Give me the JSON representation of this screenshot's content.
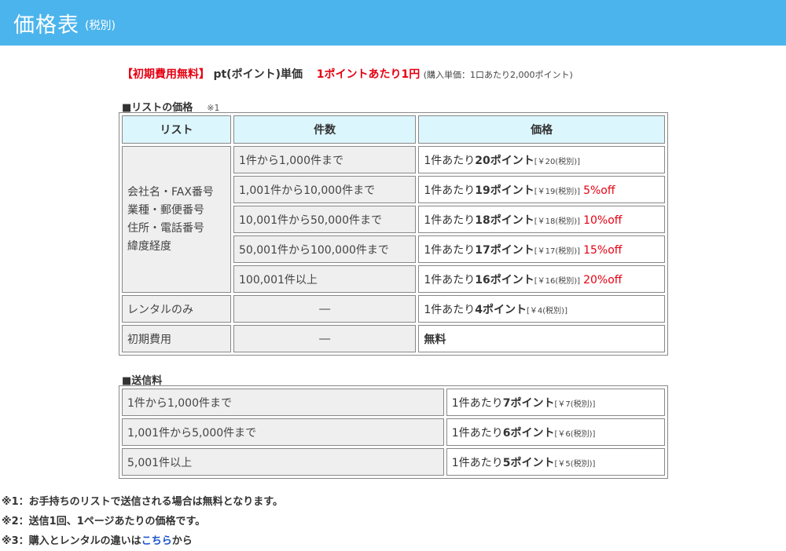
{
  "header": {
    "title": "価格表",
    "subtitle": "(税別)"
  },
  "intro": {
    "free_label": "【初期費用無料】",
    "unit_label": "pt(ポイント)単価",
    "rate": "1ポイントあたり1円",
    "note": "(購入単価：1口あたり2,000ポイント)"
  },
  "list_section": {
    "title": "■リストの価格",
    "note": "※1",
    "headers": [
      "リスト",
      "件数",
      "価格"
    ],
    "group_label_lines": [
      "会社名・FAX番号",
      "業種・郵便番号",
      "住所・電話番号",
      "緯度経度"
    ],
    "rows": [
      {
        "count": "1件から1,000件まで",
        "prefix": "1件あたり",
        "points": "20ポイント",
        "yen": "[￥20(税別)]",
        "discount": ""
      },
      {
        "count": "1,001件から10,000件まで",
        "prefix": "1件あたり",
        "points": "19ポイント",
        "yen": "[￥19(税別)]",
        "discount": "5%off"
      },
      {
        "count": "10,001件から50,000件まで",
        "prefix": "1件あたり",
        "points": "18ポイント",
        "yen": "[￥18(税別)]",
        "discount": "10%off"
      },
      {
        "count": "50,001件から100,000件まで",
        "prefix": "1件あたり",
        "points": "17ポイント",
        "yen": "[￥17(税別)]",
        "discount": "15%off"
      },
      {
        "count": "100,001件以上",
        "prefix": "1件あたり",
        "points": "16ポイント",
        "yen": "[￥16(税別)]",
        "discount": "20%off"
      }
    ],
    "rental": {
      "label": "レンタルのみ",
      "count": "―",
      "prefix": "1件あたり",
      "points": "4ポイント",
      "yen": "[￥4(税別)]"
    },
    "initial": {
      "label": "初期費用",
      "count": "―",
      "price": "無料"
    }
  },
  "send_section": {
    "title": "■送信料",
    "rows": [
      {
        "count": "1件から1,000件まで",
        "prefix": "1件あたり",
        "points": "7ポイント",
        "yen": "[￥7(税別)]"
      },
      {
        "count": "1,001件から5,000件まで",
        "prefix": "1件あたり",
        "points": "6ポイント",
        "yen": "[￥6(税別)]"
      },
      {
        "count": "5,001件以上",
        "prefix": "1件あたり",
        "points": "5ポイント",
        "yen": "[￥5(税別)]"
      }
    ]
  },
  "notes": {
    "n1": "※1：お手持ちのリストで送信される場合は無料となります。",
    "n2": "※2：送信1回、1ページあたりの価格です。",
    "n3_prefix": "※3：購入とレンタルの違いは",
    "n3_link": "こちら",
    "n3_suffix": "から"
  },
  "colors": {
    "header_bg": "#4bb4ec",
    "accent_red": "#e60012",
    "table_head_bg": "#dcf6fd",
    "cell_gray": "#efefef",
    "link": "#1a55cc"
  }
}
